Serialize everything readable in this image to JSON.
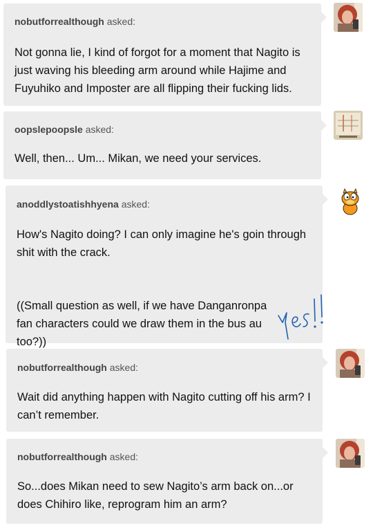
{
  "asks": [
    {
      "asker": "nobutforrealthough",
      "asked": "asked:",
      "paragraphs": [
        "Not gonna lie, I kind of forgot for a moment that Nagito is just waving his bleeding arm around while Hajime and Fuyuhiko and Imposter are all flipping their fucking lids."
      ],
      "avatar": "redhead-selfie-avatar"
    },
    {
      "asker": "oopslepoopsle",
      "asked": "asked:",
      "paragraphs": [
        "Well, then... Um... Mikan, we need your services."
      ],
      "avatar": "diagram-avatar"
    },
    {
      "asker": "anoddlystoatishhyena",
      "asked": "asked:",
      "paragraphs": [
        "How's Nagito doing? I can only imagine he's goin through shit with the crack.",
        "((Small question as well, if we have Danganronpa fan characters could we draw them in the bus au too?))"
      ],
      "avatar": "garfield-avatar"
    },
    {
      "asker": "nobutforrealthough",
      "asked": "asked:",
      "paragraphs": [
        "Wait did anything happen with Nagito cutting off his arm? I can’t remember."
      ],
      "avatar": "redhead-selfie-avatar"
    },
    {
      "asker": "nobutforrealthough",
      "asked": "asked:",
      "paragraphs": [
        "So...does Mikan need to sew Nagito’s arm back on...or does Chihiro like, reprogram him an arm?"
      ],
      "avatar": "redhead-selfie-avatar"
    }
  ],
  "handwritten_note": "yes!!",
  "colors": {
    "bubble": "#ececec",
    "text": "#111111",
    "asker": "#444444",
    "note_ink": "#1f5fb0"
  }
}
